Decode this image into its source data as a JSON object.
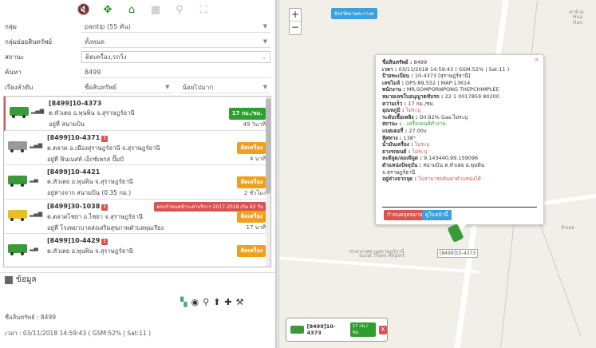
{
  "toolbar": {
    "icons": [
      "volume-icon",
      "move-icon",
      "home-icon",
      "grid-icon",
      "location-pin-icon",
      "route-icon"
    ]
  },
  "filters": {
    "group_label": "กลุ่ม",
    "group_value": "pantip (55 คัน)",
    "asset_group_label": "กลุ่มย่อยสินทรัพย์",
    "asset_group_value": "ทั้งหมด",
    "status_label": "สถานะ",
    "status_value": "ติดเครื่อง,รถวิ่ง",
    "search_label": "ค้นหา",
    "search_placeholder": "8499",
    "sort_label": "เรียงลำดับ",
    "sort_value": "ชื่อสินทรัพย์",
    "sort_order_value": "น้อยไปมาก"
  },
  "vehicles": [
    {
      "id": "[8499]10-4373",
      "addr": "ต.หัวเตย อ.พุนพิน จ.สุราษฎร์ธานี",
      "stat": "อยู่ที่ สนามบิน",
      "badge": "17 กม./ชม.",
      "time": "49 วินาที",
      "alert": ""
    },
    {
      "id": "[8499]10-4371",
      "addr": "ต.ตลาด อ.เมืองสุราษฎร์ธานี จ.สุราษฎร์ธานี",
      "stat": "อยู่ที่ ฟินเนสท์ เอ็กซ์เพรส ปั๊มป์",
      "badge": "ติดเครื่อง",
      "time": "4 นาที",
      "alert": ""
    },
    {
      "id": "[8499]10-4421",
      "addr": "ต.หัวเตย อ.พุนพิน จ.สุราษฎร์ธานี",
      "stat": "อยู่ห่างจาก สนามบิน (0.35 กม.)",
      "badge": "ติดเครื่อง",
      "time": "2 ชั่วโมง",
      "alert": ""
    },
    {
      "id": "[8499]30-1038",
      "addr": "ต.ตลาดไชยา อ.ไชยา จ.สุราษฎร์ธานี",
      "stat": "อยู่ที่ โรงพยาบาลส่งเสริมสุขภาพตำบลพุมเรียง",
      "badge": "ติดเครื่อง",
      "time": "17 นาที",
      "alert": "ครบกำหนดชำระค่าบริการ 2017-2018 เกิน 63 วัน"
    },
    {
      "id": "[8499]10-4429",
      "addr": "ต.หัวเตย อ.พุนพิน จ.สุราษฎร์ธานี",
      "stat": "",
      "badge": "ติดเครื่อง",
      "time": "",
      "alert": ""
    }
  ],
  "info": {
    "title": "ข้อมูล",
    "asset": "ชื่อสินทรัพย์ : 8499",
    "time": "เวลา : 03/11/2018 14:59:43 ( GSM:52% | Sat:11 )",
    "icons": [
      "map-icon",
      "eye-icon",
      "pin-icon",
      "navigate-icon",
      "plus-icon",
      "wrench-icon"
    ]
  },
  "map": {
    "tag": "จังหวัดตามตะรางค",
    "labels": [
      "ท่าข้าม",
      "Hua",
      "Han",
      "หัวเตย",
      "ท่าอากาศยานสุราษฎร์ธานี",
      "Surat Thani Airport"
    ],
    "marker_label": "[8499]10-4373",
    "popup": {
      "lines": [
        {
          "k": "ชื่อสินทรัพย์ :",
          "v": " 8499"
        },
        {
          "k": "เวลา :",
          "v": " 03/11/2018 14:59:43 ( GSM:52% | Sat:11 )"
        },
        {
          "k": "ป้ายทะเบียน :",
          "v": " 10-4373 [สุราษฎร์ธานี]"
        },
        {
          "k": "เลขไมล์ :",
          "v": " GPS:89,552 | MAP:13614"
        },
        {
          "k": "พนักงาน :",
          "v": " MR.SOMPORNPONG THEPCHIMPLEE"
        },
        {
          "k": "หมายเลขใบอนุญาตขับรถ :",
          "v": " 22 1 0017859 80200"
        },
        {
          "k": "ความเร็ว :",
          "v": " 17 กม./ชม."
        },
        {
          "k": "อุณหภูมิ :",
          "v": " ไม่ระบุ",
          "red": true
        },
        {
          "k": "ระดับเชื้อเพลิง :",
          "v": " Oil:92% Gas:ไม่ระบุ"
        },
        {
          "k": "สถานะ :",
          "v": " - เครื่องยนต์ทำงาน",
          "green": true
        },
        {
          "k": "แบตเตอรี่ :",
          "v": " 27.00v"
        },
        {
          "k": "ทิศทาง :",
          "v": " 138°"
        },
        {
          "k": "น้ำมันเครื่อง :",
          "v": " ไม่ระบุ",
          "red": true
        },
        {
          "k": "ยางรถยนต์ :",
          "v": " ไม่ระบุ",
          "red": true
        },
        {
          "k": "ละติจูด/ลองจิจูด :",
          "v": " 9.143440,99.159096"
        },
        {
          "k": "ตำแหน่งปัจจุบัน :",
          "v": " สนามบิน ต.หัวเตย อ.พุนพิน"
        },
        {
          "k": "",
          "v": "จ.สุราษฎร์ธานี"
        },
        {
          "k": "อยู่ห่างจากจุด :",
          "v": " ไม่สามารถค้นหาตำแหน่งได้",
          "red": true
        }
      ],
      "btn_a": "กำหนดจุดหมาย",
      "btn_b": "ดูในหน้านี้"
    },
    "bottom_tag": {
      "id": "[8499]10-4373",
      "speed": "17 กม./ชม.",
      "close": "X"
    }
  }
}
